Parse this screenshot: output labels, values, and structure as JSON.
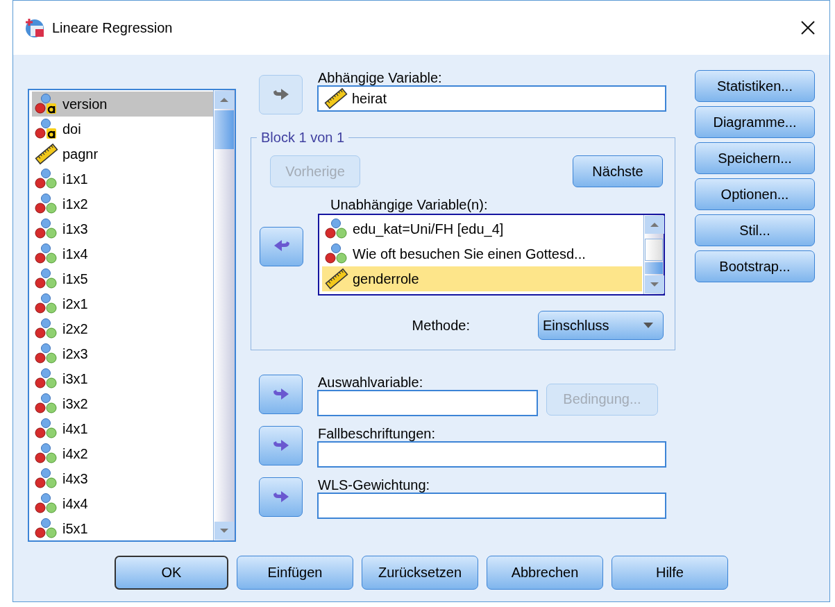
{
  "window": {
    "title": "Lineare Regression"
  },
  "variables": [
    {
      "name": "version",
      "kind": "nominal_string",
      "selected": true
    },
    {
      "name": "doi",
      "kind": "nominal_string",
      "selected": false
    },
    {
      "name": "pagnr",
      "kind": "scale",
      "selected": false
    },
    {
      "name": "i1x1",
      "kind": "nominal",
      "selected": false
    },
    {
      "name": "i1x2",
      "kind": "nominal",
      "selected": false
    },
    {
      "name": "i1x3",
      "kind": "nominal",
      "selected": false
    },
    {
      "name": "i1x4",
      "kind": "nominal",
      "selected": false
    },
    {
      "name": "i1x5",
      "kind": "nominal",
      "selected": false
    },
    {
      "name": "i2x1",
      "kind": "nominal",
      "selected": false
    },
    {
      "name": "i2x2",
      "kind": "nominal",
      "selected": false
    },
    {
      "name": "i2x3",
      "kind": "nominal",
      "selected": false
    },
    {
      "name": "i3x1",
      "kind": "nominal",
      "selected": false
    },
    {
      "name": "i3x2",
      "kind": "nominal",
      "selected": false
    },
    {
      "name": "i4x1",
      "kind": "nominal",
      "selected": false
    },
    {
      "name": "i4x2",
      "kind": "nominal",
      "selected": false
    },
    {
      "name": "i4x3",
      "kind": "nominal",
      "selected": false
    },
    {
      "name": "i4x4",
      "kind": "nominal",
      "selected": false
    },
    {
      "name": "i5x1",
      "kind": "nominal",
      "selected": false
    }
  ],
  "dependent": {
    "label": "Abhängige Variable:",
    "arrow": {
      "kind": "add",
      "disabled": true
    },
    "value": {
      "name": "heirat",
      "kind": "scale"
    }
  },
  "block": {
    "title": "Block 1 von 1",
    "buttons": [
      {
        "label": "Vorherige",
        "disabled": true
      },
      {
        "label": "Nächste",
        "disabled": false
      }
    ],
    "label": "Unabhängige Variable(n):",
    "arrow": {
      "kind": "remove",
      "disabled": false
    },
    "items": [
      {
        "name": "edu_kat=Uni/FH [edu_4]",
        "kind": "nominal",
        "selected": false
      },
      {
        "name": "Wie oft besuchen Sie einen Gottesd...",
        "kind": "nominal",
        "selected": false
      },
      {
        "name": "genderrole",
        "kind": "scale",
        "selected": true
      }
    ],
    "method_label": "Methode:",
    "method": "Einschluss"
  },
  "targets": [
    {
      "label": "Auswahlvariable:",
      "arrow": {
        "kind": "add",
        "disabled": false
      },
      "button": {
        "label": "Bedingung...",
        "disabled": true
      }
    },
    {
      "label": "Fallbeschriftungen:",
      "arrow": {
        "kind": "add",
        "disabled": false
      }
    },
    {
      "label": "WLS-Gewichtung:",
      "arrow": {
        "kind": "add",
        "disabled": false
      }
    }
  ],
  "side_buttons": [
    "Statistiken...",
    "Diagramme...",
    "Speichern...",
    "Optionen...",
    "Stil...",
    "Bootstrap..."
  ],
  "footer_buttons": [
    {
      "label": "OK",
      "default": true
    },
    {
      "label": "Einfügen",
      "default": false
    },
    {
      "label": "Zurücksetzen",
      "default": false
    },
    {
      "label": "Abbrechen",
      "default": false
    },
    {
      "label": "Hilfe",
      "default": false
    }
  ]
}
